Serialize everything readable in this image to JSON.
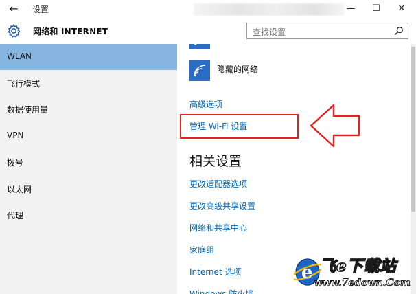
{
  "window": {
    "title": "设置",
    "back_glyph": "←",
    "minimize_glyph": "—",
    "maximize_glyph": "☐",
    "close_glyph": "✕"
  },
  "header": {
    "app_name": "网络和 INTERNET",
    "search_placeholder": "查找设置",
    "gear_icon": "gear-icon",
    "search_icon": "search-icon"
  },
  "sidebar": {
    "items": [
      {
        "label": "WLAN",
        "active": true
      },
      {
        "label": "飞行模式"
      },
      {
        "label": "数据使用量"
      },
      {
        "label": "VPN"
      },
      {
        "label": "拨号"
      },
      {
        "label": "以太网"
      },
      {
        "label": "代理"
      }
    ]
  },
  "main": {
    "hidden_network_label": "隐藏的网络",
    "advanced_options": "高级选项",
    "manage_wifi": "管理 Wi-Fi 设置",
    "related_title": "相关设置",
    "related_links": [
      "更改适配器选项",
      "更改高级共享设置",
      "网络和共享中心",
      "家庭组",
      "Internet 选项",
      "Windows 防火墙"
    ],
    "wifi_icon": "wifi-icon"
  },
  "annotation": {
    "highlight_color": "#e52220",
    "arrow_icon": "left-arrow-icon"
  },
  "watermark": {
    "logo_icon": "e-globe-logo",
    "text": "飞e下载站",
    "url": "www.7edown.Com"
  },
  "colors": {
    "accent": "#0063b1",
    "active_sidebar": "#86b6df",
    "tile": "#2b6cc4"
  }
}
